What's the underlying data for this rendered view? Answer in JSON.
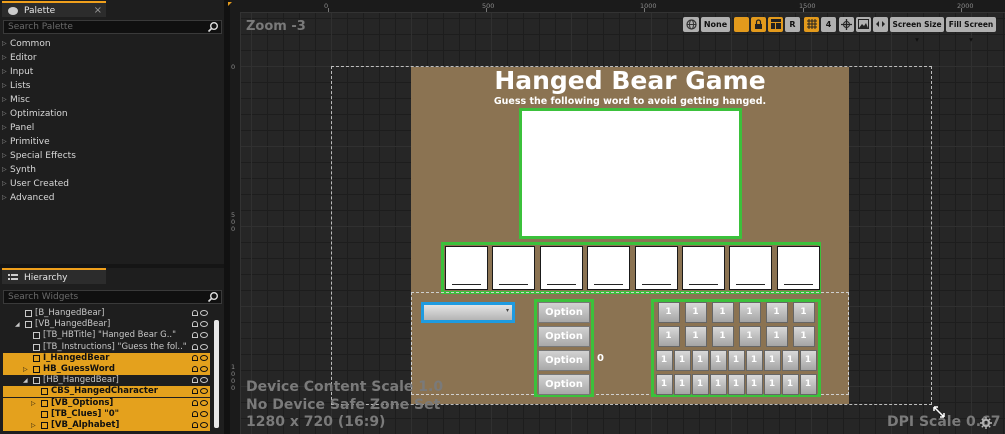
{
  "palette": {
    "tab_label": "Palette",
    "close_glyph": "×",
    "search_placeholder": "Search Palette",
    "categories": [
      "Common",
      "Editor",
      "Input",
      "Lists",
      "Misc",
      "Optimization",
      "Panel",
      "Primitive",
      "Special Effects",
      "Synth",
      "User Created",
      "Advanced"
    ]
  },
  "hierarchy": {
    "tab_label": "Hierarchy",
    "search_placeholder": "Search Widgets",
    "rows": [
      {
        "label": "[B_HangedBear]",
        "indent": 22,
        "selected": false,
        "expander": "",
        "widget": true
      },
      {
        "label": "[VB_HangedBear]",
        "indent": 22,
        "selected": false,
        "expander": "◢",
        "widget": true
      },
      {
        "label": "[TB_HBTitle] \"Hanged Bear G..\"",
        "indent": 30,
        "selected": false,
        "expander": "",
        "widget": true
      },
      {
        "label": "[TB_Instructions] \"Guess the fol..\"",
        "indent": 30,
        "selected": false,
        "expander": "",
        "widget": true
      },
      {
        "label": "I_HangedBear",
        "indent": 30,
        "selected": true,
        "expander": "",
        "widget": true
      },
      {
        "label": "HB_GuessWord",
        "indent": 30,
        "selected": true,
        "expander": "▷",
        "widget": false
      },
      {
        "label": "[HB_HangedBear]",
        "indent": 30,
        "selected": false,
        "expander": "◢",
        "widget": true
      },
      {
        "label": "CBS_HangedCharacter",
        "indent": 38,
        "selected": true,
        "expander": "",
        "widget": false
      },
      {
        "label": "[VB_Options]",
        "indent": 38,
        "selected": true,
        "expander": "▷",
        "widget": true
      },
      {
        "label": "[TB_Clues] \"0\"",
        "indent": 38,
        "selected": true,
        "expander": "",
        "widget": true
      },
      {
        "label": "[VB_Alphabet]",
        "indent": 38,
        "selected": true,
        "expander": "▷",
        "widget": true
      }
    ]
  },
  "ruler": {
    "h_labels": [
      "0",
      "500",
      "1000",
      "1500",
      "2000"
    ],
    "v_labels": [
      "0",
      "500",
      "1000"
    ]
  },
  "toolbar": {
    "none_label": "None",
    "r_label": "R",
    "grid_value": "4",
    "screen_size_label": "Screen Size",
    "fill_screen_label": "Fill Screen",
    "accent_color": "#e39a1c"
  },
  "viewport": {
    "zoom_label": "Zoom -3",
    "device_scale": "Device Content Scale 1.0",
    "safe_zone": "No Device Safe Zone Set",
    "resolution": "1280 x 720 (16:9)",
    "dpi_scale": "DPI Scale 0.67"
  },
  "game": {
    "title": "Hanged Bear Game",
    "subtitle": "Guess the following word to avoid getting hanged.",
    "background_color": "#8b7352",
    "highlight_color": "#3bc13b",
    "letter_tile_count": 8,
    "options": [
      "Option",
      "Option",
      "Option",
      "Option"
    ],
    "clues_value": "0",
    "alphabet_rows": [
      [
        "1",
        "1",
        "1",
        "1",
        "1",
        "1"
      ],
      [
        "1",
        "1",
        "1",
        "1",
        "1",
        "1"
      ],
      [
        "1",
        "1",
        "1",
        "1",
        "1",
        "1",
        "1",
        "1",
        "1"
      ],
      [
        "1",
        "1",
        "1",
        "1",
        "1",
        "1",
        "1",
        "1",
        "1"
      ]
    ]
  }
}
